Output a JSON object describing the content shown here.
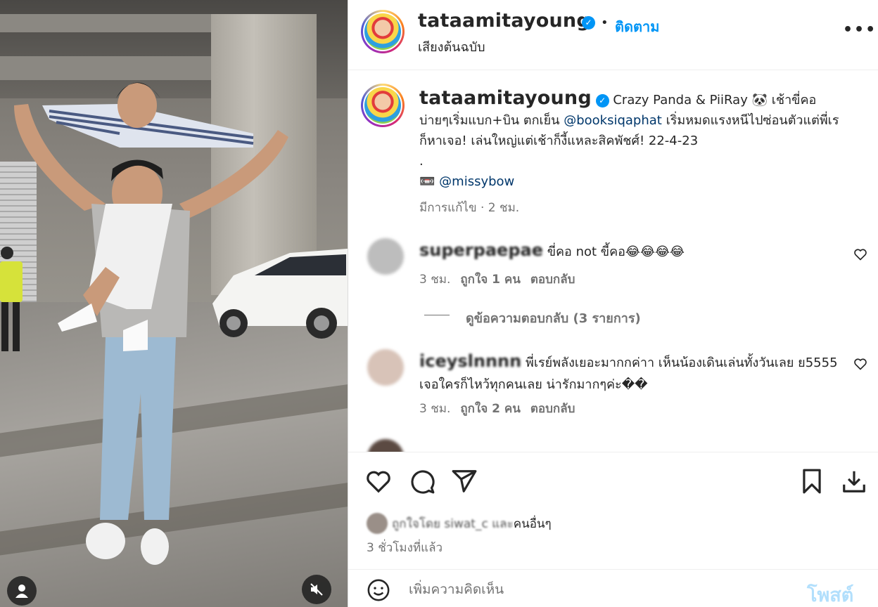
{
  "post": {
    "username": "tataamitayoung",
    "follow_label": "ติดตาม",
    "separator": "•",
    "audio_label": "เสียงต้นฉบับ",
    "more_label": "•••",
    "media": {
      "video_muted": true,
      "avatar_icon": "user-icon",
      "mute_icon": "speaker-muted-icon"
    }
  },
  "caption": {
    "username": "tataamitayoung",
    "text_1": " Crazy Panda & PiiRay 🐼 เช้าขี่คอบ่ายๆเริ่มแบก+บิน ตกเย็น ",
    "mention_1": "@booksiqaphat",
    "text_2": " เริ่มหมดแรงหนีไปซ่อนตัวแต่พี่เรก็หาเจอ! เล่นใหญ่แต่เช้าก็งี้แหละสิคพัชศ์! 22-4-23",
    "dot": ".",
    "camera_emoji": "📼",
    "mention_2": "@missybow",
    "edited_label": "มีการแก้ไข · 2 ชม."
  },
  "comments": [
    {
      "username": "superpaepae",
      "text": " ขี่คอ not ขี้คอ😂😂😂😂",
      "time": "3 ชม.",
      "likes": "ถูกใจ 1 คน",
      "reply_label": "ตอบกลับ"
    },
    {
      "username": "iceyslnnnn",
      "text": " พี่เรย์พลังเยอะมากกค่าา เห็นน้องเดินเล่นทั้งวันเลย ย5555 เจอใครก็ไหว้ทุกคนเลย น่ารักมากๆค่ะ��",
      "time": "3 ชม.",
      "likes": "ถูกใจ 2 คน",
      "reply_label": "ตอบกลับ"
    }
  ],
  "view_replies_label": "ดูข้อความตอบกลับ (3 รายการ)",
  "actions": {
    "like_icon": "heart-icon",
    "comment_icon": "comment-icon",
    "share_icon": "send-icon",
    "save_icon": "bookmark-icon",
    "download_icon": "download-icon"
  },
  "likes_summary": {
    "prefix": "ถูกใจโดย siwat_c และ",
    "suffix": "คนอื่นๆ"
  },
  "timestamp": "3 ชั่วโมงที่แล้ว",
  "comment_box": {
    "emoji_icon": "smiley-icon",
    "placeholder": "เพิ่มความคิดเห็น",
    "post_label": "โพสต์"
  },
  "colors": {
    "link": "#0095f6",
    "mention": "#00376b",
    "muted": "#737373",
    "post_disabled": "#b2dffc"
  }
}
